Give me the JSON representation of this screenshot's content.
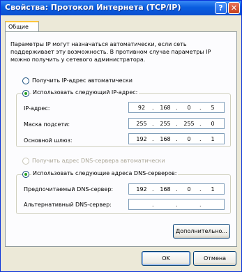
{
  "window": {
    "title": "Свойства: Протокол Интернета (TCP/IP)"
  },
  "tabs": [
    {
      "label": "Общие"
    }
  ],
  "description": "Параметры IP могут назначаться автоматически, если сеть поддерживает эту возможность. В противном случае параметры IP можно получить у сетевого администратора.",
  "ip_mode": {
    "auto_label": "Получить IP-адрес автоматически",
    "manual_label": "Использовать следующий IP-адрес:",
    "selected": "manual"
  },
  "ip_fields": [
    {
      "label": "IP-адрес:",
      "octets": [
        "92",
        "168",
        "0",
        "5"
      ]
    },
    {
      "label": "Маска подсети:",
      "octets": [
        "255",
        "255",
        "255",
        "0"
      ]
    },
    {
      "label": "Основной шлюз:",
      "octets": [
        "192",
        "168",
        "0",
        "1"
      ]
    }
  ],
  "dns_mode": {
    "auto_label": "Получить адрес DNS-сервера автоматически",
    "manual_label": "Использовать следующие адреса DNS-серверов:",
    "selected": "manual"
  },
  "dns_fields": [
    {
      "label": "Предпочитаемый DNS-сервер:",
      "octets": [
        "192",
        "168",
        "0",
        "1"
      ]
    },
    {
      "label": "Альтернативный DNS-сервер:",
      "octets": [
        "",
        "",
        "",
        ""
      ]
    }
  ],
  "buttons": {
    "advanced": "Дополнительно...",
    "ok": "OK",
    "cancel": "Отмена"
  }
}
